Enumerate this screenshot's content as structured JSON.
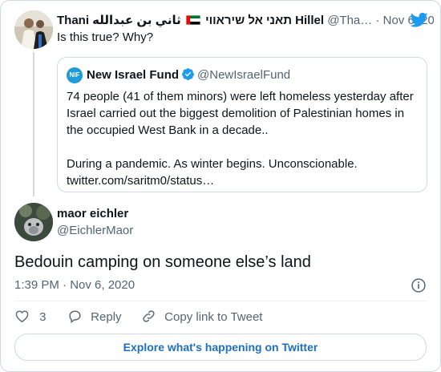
{
  "parent": {
    "name": "Thani תאני אל שיראווי",
    "name_arabic": "ثاني بن عبدالله Hillel",
    "handle": "@Tha…",
    "separator": "·",
    "date": "Nov 6, 2020",
    "text": "Is this true? Why?",
    "quote": {
      "avatar_text": "NIF",
      "name": "New Israel Fund",
      "handle": "@NewIsraelFund",
      "text_lines": [
        "74 people (41 of them minors) were left homeless yesterday after",
        "Israel carried out the biggest demolition of Palestinian homes in",
        "the occupied West Bank in a decade.."
      ],
      "text_lines2": [
        "During a pandemic. As winter begins. Unconscionable.",
        "twitter.com/saritm0/status…"
      ]
    }
  },
  "reply": {
    "name": "maor eichler",
    "handle": "@EichlerMaor",
    "text": "Bedouin camping on someone else’s land",
    "meta": "1:39 PM · Nov 6, 2020"
  },
  "actions": {
    "like_count": "3",
    "reply_label": "Reply",
    "copy_label": "Copy link to Tweet"
  },
  "explore_label": "Explore what's happening on Twitter",
  "colors": {
    "twitter_blue": "#1d9bf0",
    "text": "#0f1419",
    "muted": "#536471",
    "border": "#cfd9de"
  },
  "icons": [
    "twitter-bird-icon",
    "verified-badge-icon",
    "info-icon",
    "heart-icon",
    "reply-icon",
    "link-icon",
    "uae-flag-icon"
  ]
}
